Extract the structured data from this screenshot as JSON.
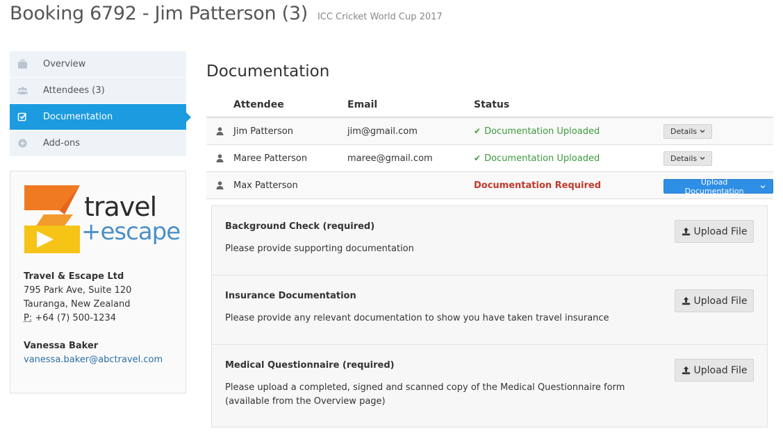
{
  "header": {
    "title": "Booking 6792 - Jim Patterson (3)",
    "subtitle": "ICC Cricket World Cup 2017"
  },
  "sidebar": {
    "items": [
      {
        "label": "Overview",
        "icon": "briefcase-icon",
        "active": false
      },
      {
        "label": "Attendees (3)",
        "icon": "users-icon",
        "active": false
      },
      {
        "label": "Documentation",
        "icon": "checkbox-icon",
        "active": true
      },
      {
        "label": "Add-ons",
        "icon": "plus-circle-icon",
        "active": false
      }
    ]
  },
  "agency": {
    "logo_word1": "travel",
    "logo_word2": "+escape",
    "company": "Travel & Escape Ltd",
    "address1": "795 Park Ave, Suite 120",
    "address2": "Tauranga, New Zealand",
    "phone_label": "P:",
    "phone": "+64 (7) 500-1234",
    "contact_name": "Vanessa Baker",
    "contact_email": "vanessa.baker@abctravel.com"
  },
  "documentation": {
    "title": "Documentation",
    "columns": [
      "Attendee",
      "Email",
      "Status"
    ],
    "rows": [
      {
        "name": "Jim Patterson",
        "email": "jim@gmail.com",
        "status": "Documentation Uploaded",
        "action": "Details"
      },
      {
        "name": "Maree Patterson",
        "email": "maree@gmail.com",
        "status": "Documentation Uploaded",
        "action": "Details"
      },
      {
        "name": "Max Patterson",
        "email": "",
        "status": "Documentation Required",
        "action": "Upload Documentation"
      }
    ],
    "requirements": [
      {
        "title": "Background Check (required)",
        "description": "Please provide supporting documentation",
        "button": "Upload File"
      },
      {
        "title": "Insurance Documentation",
        "description": "Please provide any relevant documentation to show you have taken travel insurance",
        "button": "Upload File"
      },
      {
        "title": "Medical Questionnaire (required)",
        "description": "Please upload a completed, signed and scanned copy of the Medical Questionnaire form (available from the Overview page)",
        "button": "Upload File"
      }
    ]
  },
  "colors": {
    "accent": "#1c9be0",
    "success": "#3c9a3c",
    "danger": "#c0392b",
    "primary_button": "#2f8ee5",
    "logo_orange": "#f07a22",
    "logo_yellow": "#f6c416",
    "logo_blue": "#4a90c8"
  }
}
